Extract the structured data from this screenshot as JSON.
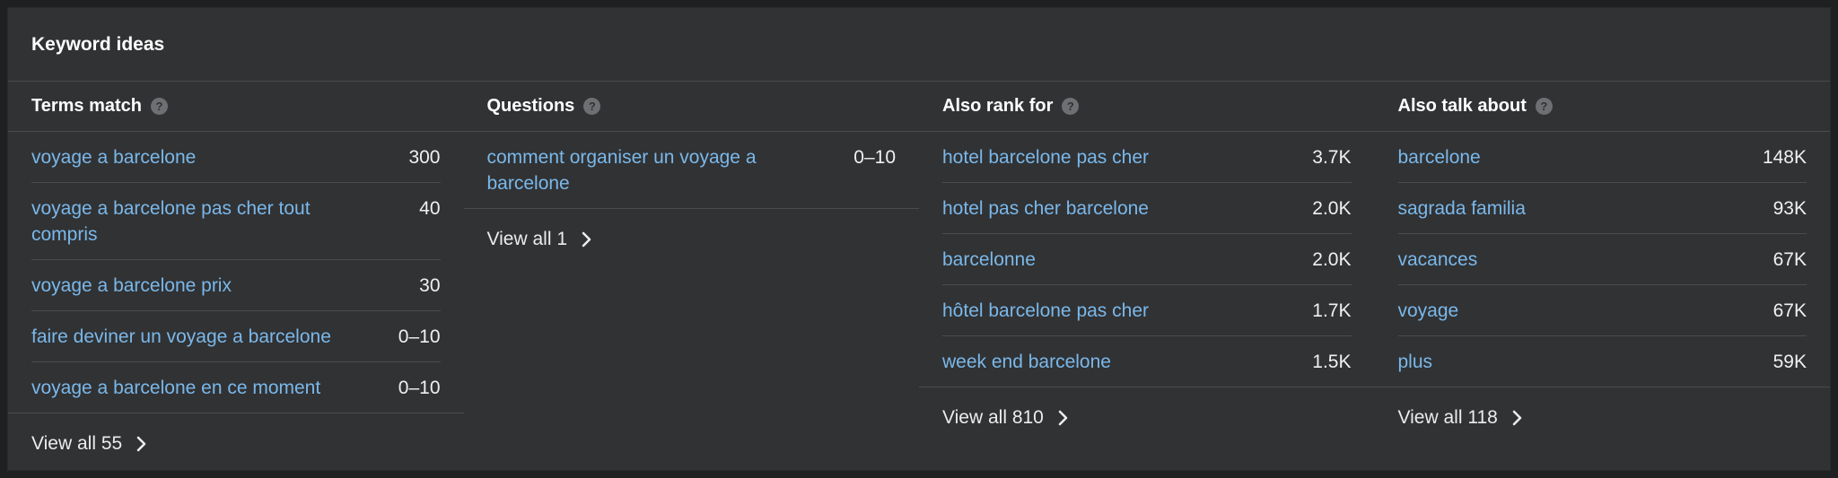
{
  "panel": {
    "title": "Keyword ideas"
  },
  "columns": [
    {
      "title": "Terms match",
      "rows": [
        {
          "keyword": "voyage a barcelone",
          "volume": "300"
        },
        {
          "keyword": "voyage a barcelone pas cher tout compris",
          "volume": "40"
        },
        {
          "keyword": "voyage a barcelone prix",
          "volume": "30"
        },
        {
          "keyword": "faire deviner un voyage a barcelone",
          "volume": "0–10"
        },
        {
          "keyword": "voyage a barcelone en ce moment",
          "volume": "0–10"
        }
      ],
      "view_all": "View all 55"
    },
    {
      "title": "Questions",
      "rows": [
        {
          "keyword": "comment organiser un voyage a barcelone",
          "volume": "0–10"
        }
      ],
      "view_all": "View all 1"
    },
    {
      "title": "Also rank for",
      "rows": [
        {
          "keyword": "hotel barcelone pas cher",
          "volume": "3.7K"
        },
        {
          "keyword": "hotel pas cher barcelone",
          "volume": "2.0K"
        },
        {
          "keyword": "barcelonne",
          "volume": "2.0K"
        },
        {
          "keyword": "hôtel barcelone pas cher",
          "volume": "1.7K"
        },
        {
          "keyword": "week end barcelone",
          "volume": "1.5K"
        }
      ],
      "view_all": "View all 810"
    },
    {
      "title": "Also talk about",
      "rows": [
        {
          "keyword": "barcelone",
          "volume": "148K"
        },
        {
          "keyword": "sagrada familia",
          "volume": "93K"
        },
        {
          "keyword": "vacances",
          "volume": "67K"
        },
        {
          "keyword": "voyage",
          "volume": "67K"
        },
        {
          "keyword": "plus",
          "volume": "59K"
        }
      ],
      "view_all": "View all 118"
    }
  ],
  "icons": {
    "help": "question-circle-icon",
    "view_all": "chevron-right-icon"
  },
  "colors": {
    "link": "#7ab8ea",
    "panel_bg": "#313234",
    "page_bg": "#1f2022"
  }
}
